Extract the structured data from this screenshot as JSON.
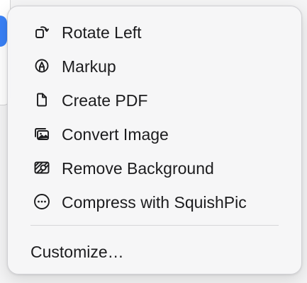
{
  "menu": {
    "items": [
      {
        "label": "Rotate Left",
        "icon": "rotate-left-icon"
      },
      {
        "label": "Markup",
        "icon": "markup-icon"
      },
      {
        "label": "Create PDF",
        "icon": "document-icon"
      },
      {
        "label": "Convert Image",
        "icon": "photo-stack-icon"
      },
      {
        "label": "Remove Background",
        "icon": "remove-background-icon"
      },
      {
        "label": "Compress with SquishPic",
        "icon": "ellipsis-circle-icon"
      }
    ],
    "customize_label": "Customize…"
  },
  "colors": {
    "menu_background": "#f6f6f7",
    "text": "#1c1c1e",
    "icon": "#1c1c1e",
    "accent": "#3a82f7"
  }
}
